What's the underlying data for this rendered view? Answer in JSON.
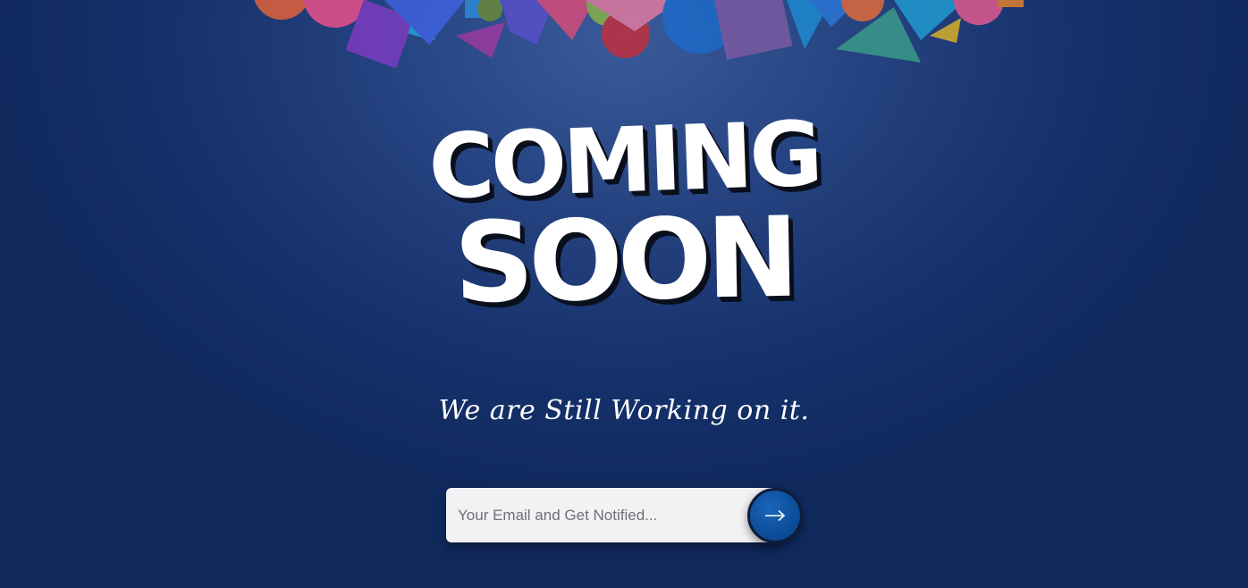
{
  "hero": {
    "line1": "COMING",
    "line2": "SOON"
  },
  "tagline": "We are Still Working on it.",
  "notify_form": {
    "email_placeholder": "Your Email and Get Notified...",
    "email_value": "",
    "submit_icon": "arrow-right-icon"
  },
  "colors": {
    "background": "#1a3570",
    "button": "#0e4f9c",
    "input": "#f2f2f4"
  }
}
